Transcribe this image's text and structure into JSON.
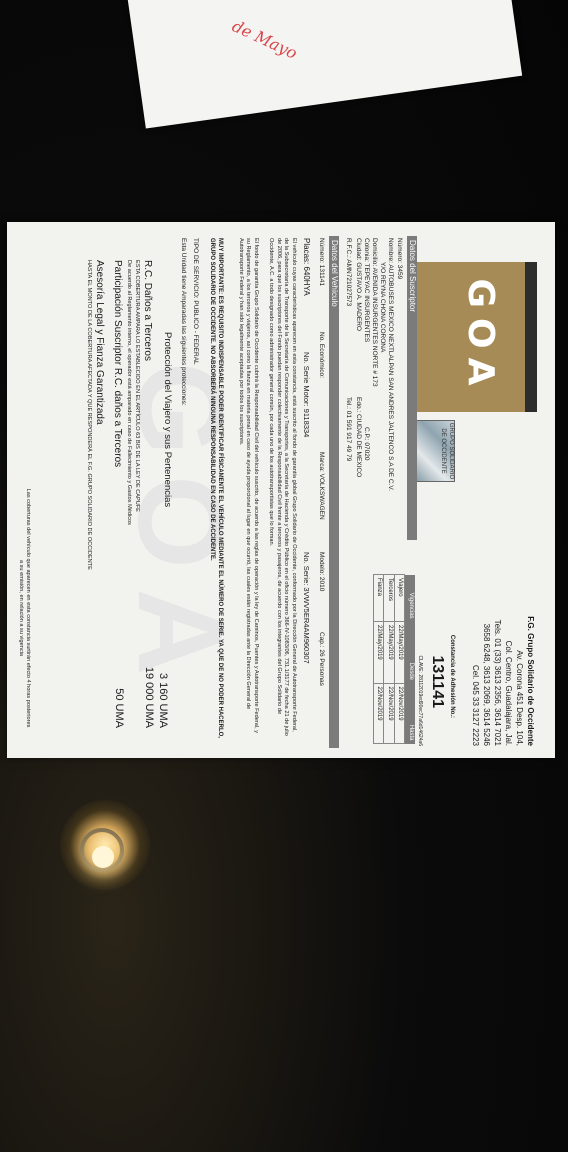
{
  "scrap": {
    "handwriting": "de Mayo"
  },
  "document": {
    "logo": "GOA",
    "holo_label": "GRUPO SOLIDARIO DE OCCIDENTE",
    "watermark": "GOA",
    "company": {
      "name": "F.G. Grupo Solidario de Occidente",
      "address1": "Av. Corona 451 Desp. 104,",
      "address2": "Col. Centro, Guadalajara, Jal.",
      "phones1": "Tels. 01 (33) 3613 2356, 3614 7021",
      "phones2": "3658 6248, 3613 2069, 3614 5246",
      "cel": "Cel. 045 33 3127 2223",
      "constancia_label": "Constancia de Adhesión No.:",
      "constancia_number": "131141",
      "clave": "CLAVE: 28112019ed90ec77a6d14624a6"
    },
    "subscriber": {
      "header": "Datos del Suscriptor",
      "numero": "Número: 3459",
      "nombre": "Nombre: AUTOBUSES MEXICO NEXTLALPAN SAN ANDRES JALTENCO S.A DE C.V.",
      "nombre2": "Y/O   REYNA CHONA CORONA",
      "domicilio": "Domicilio: AVENIDA INSURGENTES NORTE # 173",
      "colonia": "Colonia: TEPEYAC INSURGENTES",
      "cp": "C.P.: 07020",
      "ciudad": "Ciudad: GUSTAVO A. MADERO",
      "edo": "Edo.: CIUDAD DE MEXICO",
      "rfc": "R.F.C.: AMN721027573",
      "tel": "Tel.: 01 591 917 49 79"
    },
    "vigencias": {
      "header": "Vigencias",
      "col_start": "Desde",
      "col_end": "Hasta",
      "rows": [
        {
          "label": "Viajero",
          "from": "22/May/2019",
          "to": "22/Nov/2019"
        },
        {
          "label": "Terceros",
          "from": "22/May/2019",
          "to": "22/Nov/2019"
        },
        {
          "label": "Fianza",
          "from": "22/May/2019",
          "to": "22/Nov/2019"
        }
      ]
    },
    "vehicle": {
      "header": "Datos del Vehículo",
      "numero": "Número: 131141",
      "economico": "No. Económico:",
      "marca": "Marca: VOLKSWAGEN",
      "modelo": "Modelo: 2010",
      "cap": "Cap.: 26 Personas",
      "placas": "Placas: 640HYA",
      "motor": "No. Serie Motor: 9118334",
      "serie": "No. Serie: 3VWV5ER4AM960307"
    },
    "para1": "El vehículo cuyas características aparecen en esta constancia, está suscrito al fondo de garantía global Grupo Solidario de Occidente, conformado por la Dirección General de Autotransporte Federal, de la Subsecretaría de Transporte de la Secretaría de Comunicaciones y Transportes, a la Secretaría de Hacienda y Crédito Público en el oficio número 366-IV-1083/06, 731.1/3177 de fecha 21 de julio de 2006, para que los suscriptores del Fondo puedan responder colectivamente de la Responsabilidad Civil frente a terceros y pasajeros, de acuerdo con los integrantes del Grupo Solidario de Occidente, A.C. a todo designado como administrador general común, por cada uno de los autotransportistas que lo forman.",
    "para2": "El fondo de garantía Grupo Solidario de Occidente cubrirá la Responsabilidad Civil del vehículo suscrito, de acuerdo a las reglas de operación y la ley de Caminos, Puentes y Autotransporte Federal, y su Reglamento, a los terceros y viajeros, así como la fianza en materia penal en caso de ayuda proporcional al lugar en que ocurrió, las cuales están registradas ante la Dirección General de Autotransporte Federal y han sido legalmente aceptadas por todos los suscriptores.",
    "important": "MUY IMPORTANTE: ES REQUISITO INDISPENSABLE PODER IDENTIFICAR FÍSICAMENTE EL VEHÍCULO MEDIANTE EL NÚMERO DE SERIE. YA QUE DE NO PODER HACERLO, GRUPO SOLIDARIO DE OCCIDENTE. NO ABSORBERÁ NINGUNA RESPONSABILIDAD EN CASO DE ACCIDENTE.",
    "servicio": "TIPO DE SERVICIO: PUBLICO - FEDERAL",
    "amparada": "Esta Unidad tiene Amparadas las siguientes protecciones:",
    "cov_title": "Protección del Viajero y sus Pertenencias",
    "cov_title_amount": "3 160 UMA",
    "rc_title": "R.C. Daños a Terceros",
    "rc_amount": "19 000 UMA",
    "rc_desc": "ESTA COBERTURA AMPARA LO ESTABLECIDO EN EL ARTÍCULO 63 BIS DE LA LEY DE CAPUFE",
    "rc_desc2": "De acuerdo al Reglamento interno, el operador está amparado en caso de Fallecimiento y Gastos Médicos",
    "part_title": "Participación Suscriptor R.C. daños a Terceros",
    "part_amount": "50 UMA",
    "legal_title": "Asesoría Legal y Fianza Garantizada",
    "legal_desc": "HASTA EL MONTO DE LA COBERTURA AFECTADA Y QUE RESPONDERÁ EL F.G. GRUPO SOLIDARIO DE OCCIDENTE",
    "bottom": "Las coberturas del vehículo que aparecen en esta constancia surtirán efecto 4 horas posteriores a su emisión, en relación a su vigencia"
  }
}
